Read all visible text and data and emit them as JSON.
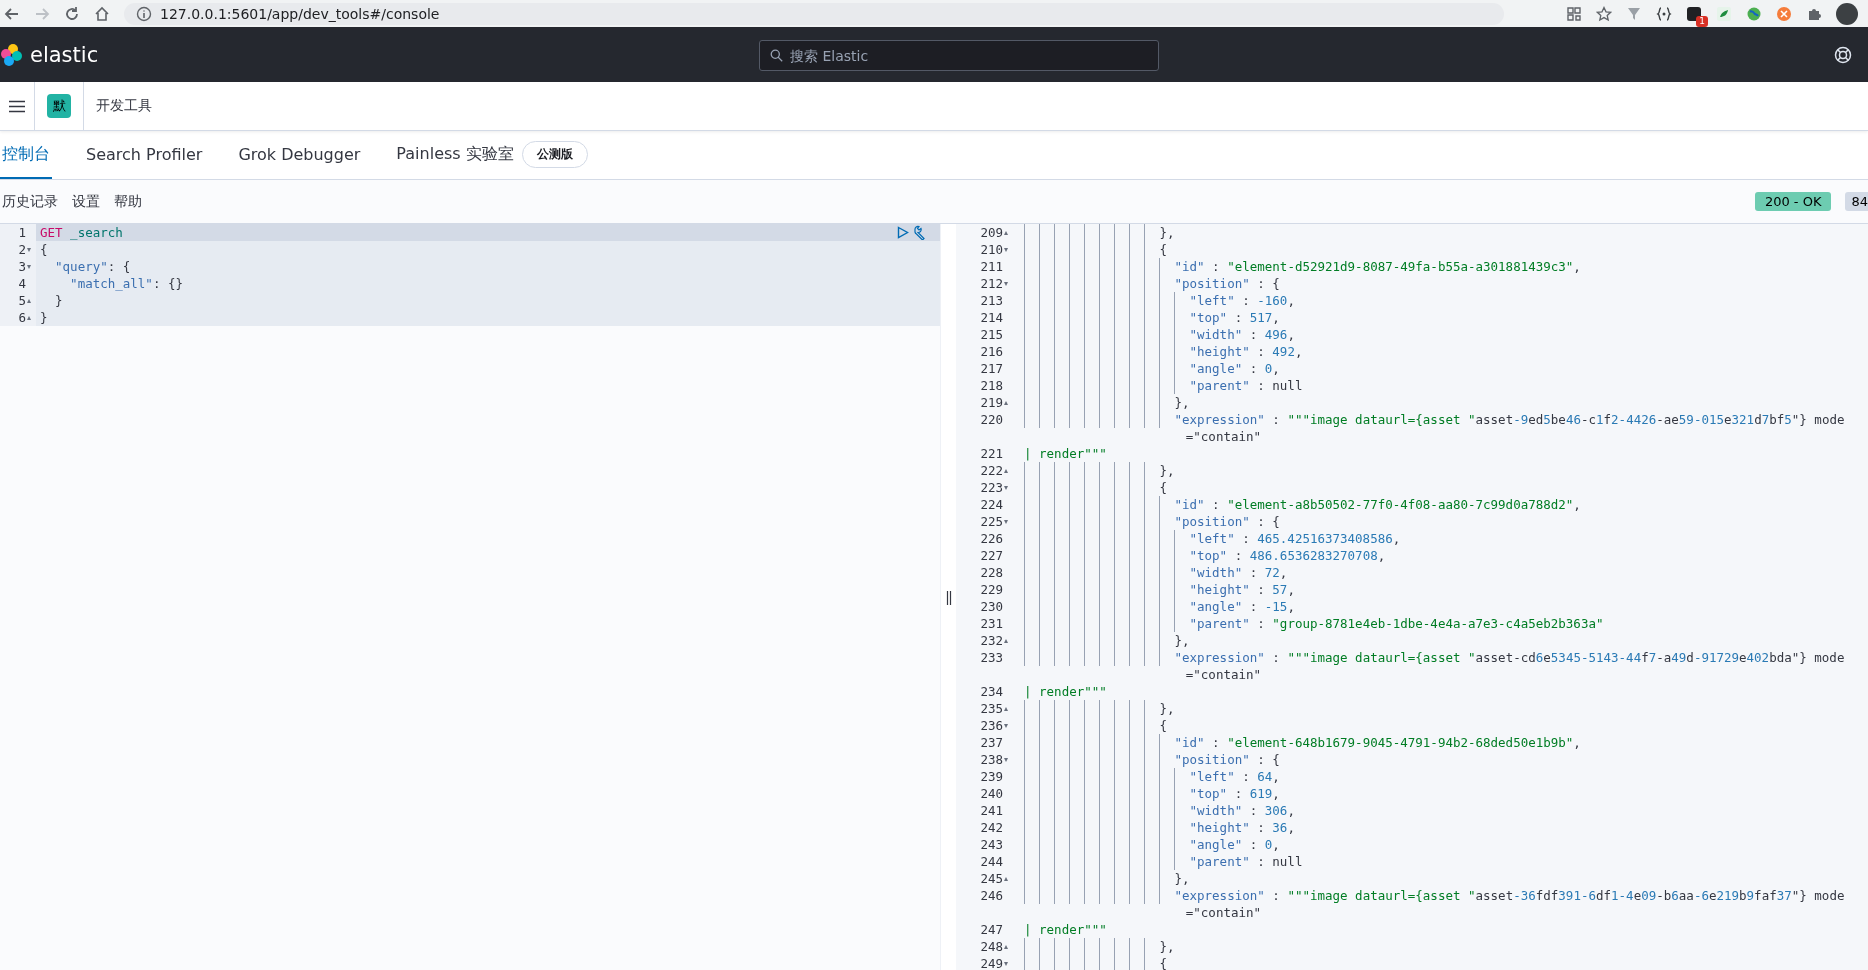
{
  "browser": {
    "url": "127.0.0.1:5601/app/dev_tools#/console",
    "extension_badge": "1"
  },
  "header": {
    "logo_text": "elastic",
    "search_placeholder": "搜索 Elastic"
  },
  "breadcrumb": {
    "space_avatar": "默",
    "title": "开发工具"
  },
  "tabs": [
    {
      "label": "控制台",
      "selected": true
    },
    {
      "label": "Search Profiler",
      "selected": false
    },
    {
      "label": "Grok Debugger",
      "selected": false
    },
    {
      "label": "Painless 实验室",
      "selected": false,
      "badge": "公测版"
    }
  ],
  "toolbar": {
    "links": [
      "历史记录",
      "设置",
      "帮助"
    ],
    "status": "200 - OK",
    "time": "84"
  },
  "request": {
    "lines": [
      {
        "number": "1",
        "method": "GET",
        "path": "_search"
      },
      {
        "number": "2",
        "fold": "▾",
        "text": "{"
      },
      {
        "number": "3",
        "fold": "▾",
        "text": "  \"query\": {"
      },
      {
        "number": "4",
        "text": "    \"match_all\": {}"
      },
      {
        "number": "5",
        "fold": "▴",
        "text": "  }"
      },
      {
        "number": "6",
        "fold": "▴",
        "text": "}"
      }
    ]
  },
  "response": {
    "lines": [
      {
        "number": "209",
        "fold": "▴",
        "kind": "json",
        "text": "                  },"
      },
      {
        "number": "210",
        "fold": "▾",
        "kind": "json",
        "text": "                  {"
      },
      {
        "number": "211",
        "kind": "json",
        "text": "                    \"id\" : \"element-d52921d9-8087-49fa-b55a-a301881439c3\","
      },
      {
        "number": "212",
        "fold": "▾",
        "kind": "json",
        "text": "                    \"position\" : {"
      },
      {
        "number": "213",
        "kind": "json",
        "text": "                      \"left\" : -160,"
      },
      {
        "number": "214",
        "kind": "json",
        "text": "                      \"top\" : 517,"
      },
      {
        "number": "215",
        "kind": "json",
        "text": "                      \"width\" : 496,"
      },
      {
        "number": "216",
        "kind": "json",
        "text": "                      \"height\" : 492,"
      },
      {
        "number": "217",
        "kind": "json",
        "text": "                      \"angle\" : 0,"
      },
      {
        "number": "218",
        "kind": "json",
        "text": "                      \"parent\" : null"
      },
      {
        "number": "219",
        "fold": "▴",
        "kind": "json",
        "text": "                    },"
      },
      {
        "number": "220",
        "kind": "json",
        "text": "                    \"expression\" : \"\"\"image dataurl={asset \"asset-9ed5be46-c1f2-4426-ae59-015e321d7bf5\"} mode",
        "continuation": "=\"contain\""
      },
      {
        "number": "221",
        "kind": "string",
        "text": "| render\"\"\""
      },
      {
        "number": "222",
        "fold": "▴",
        "kind": "json",
        "text": "                  },"
      },
      {
        "number": "223",
        "fold": "▾",
        "kind": "json",
        "text": "                  {"
      },
      {
        "number": "224",
        "kind": "json",
        "text": "                    \"id\" : \"element-a8b50502-77f0-4f08-aa80-7c99d0a788d2\","
      },
      {
        "number": "225",
        "fold": "▾",
        "kind": "json",
        "text": "                    \"position\" : {"
      },
      {
        "number": "226",
        "kind": "json",
        "text": "                      \"left\" : 465.42516373408586,"
      },
      {
        "number": "227",
        "kind": "json",
        "text": "                      \"top\" : 486.6536283270708,"
      },
      {
        "number": "228",
        "kind": "json",
        "text": "                      \"width\" : 72,"
      },
      {
        "number": "229",
        "kind": "json",
        "text": "                      \"height\" : 57,"
      },
      {
        "number": "230",
        "kind": "json",
        "text": "                      \"angle\" : -15,"
      },
      {
        "number": "231",
        "kind": "json",
        "text": "                      \"parent\" : \"group-8781e4eb-1dbe-4e4a-a7e3-c4a5eb2b363a\""
      },
      {
        "number": "232",
        "fold": "▴",
        "kind": "json",
        "text": "                    },"
      },
      {
        "number": "233",
        "kind": "json",
        "text": "                    \"expression\" : \"\"\"image dataurl={asset \"asset-cd6e5345-5143-44f7-a49d-91729e402bda\"} mode",
        "continuation": "=\"contain\""
      },
      {
        "number": "234",
        "kind": "string",
        "text": "| render\"\"\""
      },
      {
        "number": "235",
        "fold": "▴",
        "kind": "json",
        "text": "                  },"
      },
      {
        "number": "236",
        "fold": "▾",
        "kind": "json",
        "text": "                  {"
      },
      {
        "number": "237",
        "kind": "json",
        "text": "                    \"id\" : \"element-648b1679-9045-4791-94b2-68ded50e1b9b\","
      },
      {
        "number": "238",
        "fold": "▾",
        "kind": "json",
        "text": "                    \"position\" : {"
      },
      {
        "number": "239",
        "kind": "json",
        "text": "                      \"left\" : 64,"
      },
      {
        "number": "240",
        "kind": "json",
        "text": "                      \"top\" : 619,"
      },
      {
        "number": "241",
        "kind": "json",
        "text": "                      \"width\" : 306,"
      },
      {
        "number": "242",
        "kind": "json",
        "text": "                      \"height\" : 36,"
      },
      {
        "number": "243",
        "kind": "json",
        "text": "                      \"angle\" : 0,"
      },
      {
        "number": "244",
        "kind": "json",
        "text": "                      \"parent\" : null"
      },
      {
        "number": "245",
        "fold": "▴",
        "kind": "json",
        "text": "                    },"
      },
      {
        "number": "246",
        "kind": "json",
        "text": "                    \"expression\" : \"\"\"image dataurl={asset \"asset-36fdf391-6df1-4e09-b6aa-6e219b9faf37\"} mode",
        "continuation": "=\"contain\""
      },
      {
        "number": "247",
        "kind": "string",
        "text": "| render\"\"\""
      },
      {
        "number": "248",
        "fold": "▴",
        "kind": "json",
        "text": "                  },"
      },
      {
        "number": "249",
        "fold": "▾",
        "kind": "json",
        "text": "                  {"
      }
    ]
  }
}
